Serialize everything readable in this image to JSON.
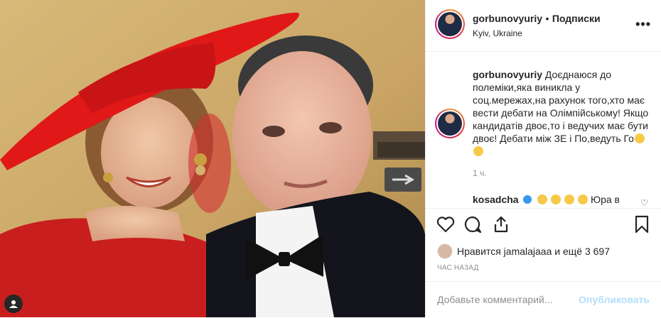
{
  "header": {
    "username": "gorbunovyuriy",
    "dot": "•",
    "follow_label": "Подписки",
    "location": "Kyiv, Ukraine"
  },
  "caption": {
    "username": "gorbunovyuriy",
    "text": "Доєднаюся до полеміки,яка виникла у соц.мережах,на рахунок того,хто має вести дебати на Олімпійському! Якщо кандидатів двоє,то і ведучих має бути двоє! Дебати між ЗЕ і По,ведуть Го",
    "time": "1 ч."
  },
  "comment": {
    "username": "kosadcha",
    "text": "Юра в"
  },
  "likes": {
    "text": "Нравится jamalajaaa и ещё 3 697"
  },
  "post_time": "ЧАС НАЗАД",
  "add_comment": {
    "placeholder": "Добавьте комментарий...",
    "publish_label": "Опубликовать"
  },
  "colors": {
    "accent": "#3897f0",
    "publish_disabled": "#b2dffc",
    "muted": "#8e8e8e"
  }
}
